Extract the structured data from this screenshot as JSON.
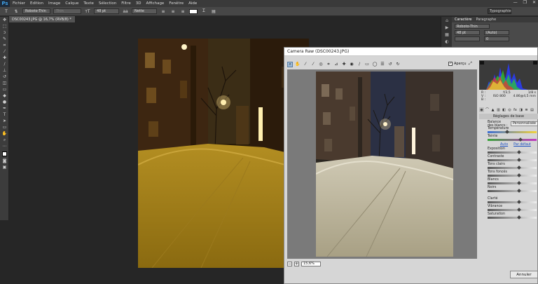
{
  "app": {
    "logo": "Ps",
    "window_controls": [
      "—",
      "❐",
      "✕"
    ]
  },
  "menu": [
    "Fichier",
    "Edition",
    "Image",
    "Calque",
    "Texte",
    "Sélection",
    "Filtre",
    "3D",
    "Affichage",
    "Fenêtre",
    "Aide"
  ],
  "options_bar": {
    "font_family": "Roboto-Thin",
    "font_style": "Thin",
    "font_size": "48 pt",
    "antialias": "Nette",
    "workspace": "Typographie"
  },
  "document_tab": "DSC00243.JPG @ 16,7% (RVB/8) *",
  "character_panel": {
    "tabs": [
      "Caractère",
      "Paragraphe"
    ],
    "font_family": "Roboto-Thin",
    "font_size": "48 pt",
    "leading": "(Auto)",
    "tracking": "0"
  },
  "camera_raw": {
    "title": "Camera Raw (DSC00243.JPG)",
    "preview_label": "Aperçu",
    "preview_checked": true,
    "zoom": "15,6%",
    "rgb": [
      {
        "label": "R :",
        "value": "---"
      },
      {
        "label": "V :",
        "value": "---"
      },
      {
        "label": "B :",
        "value": "---"
      }
    ],
    "exif": [
      "f/3,5",
      "1/8 s",
      "ISO 800",
      "4.86@4,5 mm"
    ],
    "panel_title": "Réglages de base",
    "white_balance_label": "Balance des blancs :",
    "white_balance_value": "Personnalisée",
    "auto_link": "Auto",
    "default_link": "Par défaut",
    "sliders": [
      {
        "label": "Température",
        "value": 0.4,
        "track": "temp"
      },
      {
        "label": "Teinte",
        "value": 0.68,
        "track": "tint"
      },
      {
        "label": "Exposition",
        "value": 0.65,
        "track": "gray"
      },
      {
        "label": "Contraste",
        "value": 0.65,
        "track": "gray"
      },
      {
        "label": "Tons clairs",
        "value": 0.65,
        "track": "gray"
      },
      {
        "label": "Tons foncés",
        "value": 0.65,
        "track": "gray"
      },
      {
        "label": "Blancs",
        "value": 0.65,
        "track": "gray"
      },
      {
        "label": "Noirs",
        "value": 0.65,
        "track": "gray"
      },
      {
        "label": "Clarté",
        "value": 0.65,
        "track": "gray"
      },
      {
        "label": "Vibrance",
        "value": 0.65,
        "track": "gray"
      },
      {
        "label": "Saturation",
        "value": 0.65,
        "track": "gray"
      }
    ],
    "cancel_label": "Annuler"
  },
  "colors": {
    "accent": "#3fa0e6",
    "link": "#1b4fbf"
  }
}
